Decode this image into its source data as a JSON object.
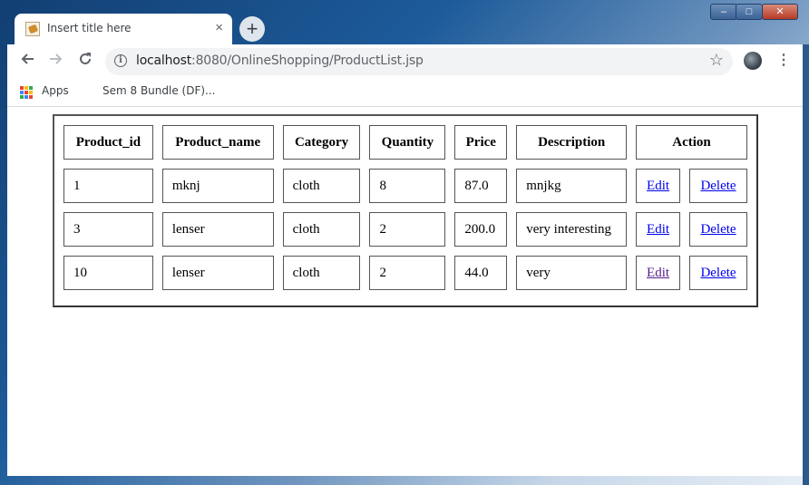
{
  "browser": {
    "tab_title": "Insert title here",
    "tab_close": "×",
    "new_tab": "+",
    "url_host": "localhost",
    "url_path": ":8080/OnlineShopping/ProductList.jsp",
    "window_controls": {
      "minimize": "–",
      "maximize": "□",
      "close": "✕"
    },
    "bookmarks": [
      "Apps",
      "Sem 8 Bundle (DF)..."
    ],
    "icons": [
      "back-arrow-icon",
      "forward-arrow-icon",
      "reload-icon",
      "info-icon",
      "star-icon",
      "profile-avatar",
      "more-menu-icon",
      "apps-grid-icon"
    ]
  },
  "table": {
    "headers": [
      "Product_id",
      "Product_name",
      "Category",
      "Quantity",
      "Price",
      "Description",
      "Action"
    ],
    "rows": [
      {
        "id": "1",
        "name": "mknj",
        "category": "cloth",
        "quantity": "8",
        "price": "87.0",
        "description": "mnjkg",
        "edit": "Edit",
        "delete": "Delete"
      },
      {
        "id": "3",
        "name": "lenser",
        "category": "cloth",
        "quantity": "2",
        "price": "200.0",
        "description": "very interesting",
        "edit": "Edit",
        "delete": "Delete"
      },
      {
        "id": "10",
        "name": "lenser",
        "category": "cloth",
        "quantity": "2",
        "price": "44.0",
        "description": "very",
        "edit": "Edit",
        "delete": "Delete"
      }
    ]
  },
  "colors": {
    "link": "#0000ee",
    "visited_link": "#551a8b"
  }
}
